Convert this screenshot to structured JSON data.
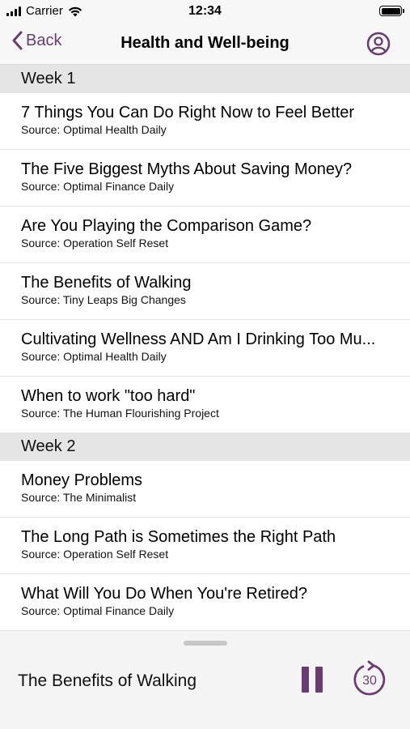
{
  "status": {
    "carrier": "Carrier",
    "time": "12:34",
    "icons": [
      "signal-icon",
      "wifi-icon",
      "battery-icon"
    ]
  },
  "nav": {
    "back_label": "Back",
    "title": "Health and Well-being",
    "back_icon": "chevron-left-icon",
    "profile_icon": "user-circle-icon"
  },
  "sections": [
    {
      "header": "Week 1",
      "items": [
        {
          "title": "7 Things You Can Do Right Now to Feel Better",
          "source": "Source: Optimal Health Daily"
        },
        {
          "title": "The Five Biggest Myths About Saving Money?",
          "source": "Source: Optimal Finance Daily"
        },
        {
          "title": "Are You Playing the Comparison Game?",
          "source": "Source: Operation Self Reset"
        },
        {
          "title": "The Benefits of Walking",
          "source": "Source: Tiny Leaps Big Changes"
        },
        {
          "title": "Cultivating Wellness AND Am I Drinking Too Mu...",
          "source": "Source: Optimal Health Daily"
        },
        {
          "title": "When to work \"too hard\"",
          "source": "Source: The Human Flourishing Project"
        }
      ]
    },
    {
      "header": "Week 2",
      "items": [
        {
          "title": "Money Problems",
          "source": "Source: The Minimalist"
        },
        {
          "title": "The Long Path is Sometimes the Right Path",
          "source": "Source: Operation Self Reset"
        },
        {
          "title": "What Will You Do When You're Retired?",
          "source": "Source: Optimal Finance Daily"
        }
      ]
    }
  ],
  "player": {
    "now_playing": "The Benefits of Walking",
    "skip_label": "30",
    "pause_icon": "pause-icon",
    "skip_icon": "skip-forward-30-icon"
  },
  "colors": {
    "accent": "#6b3b73",
    "section_header_bg": "#e5e5e5",
    "bar_bg": "#f7f7f7"
  }
}
